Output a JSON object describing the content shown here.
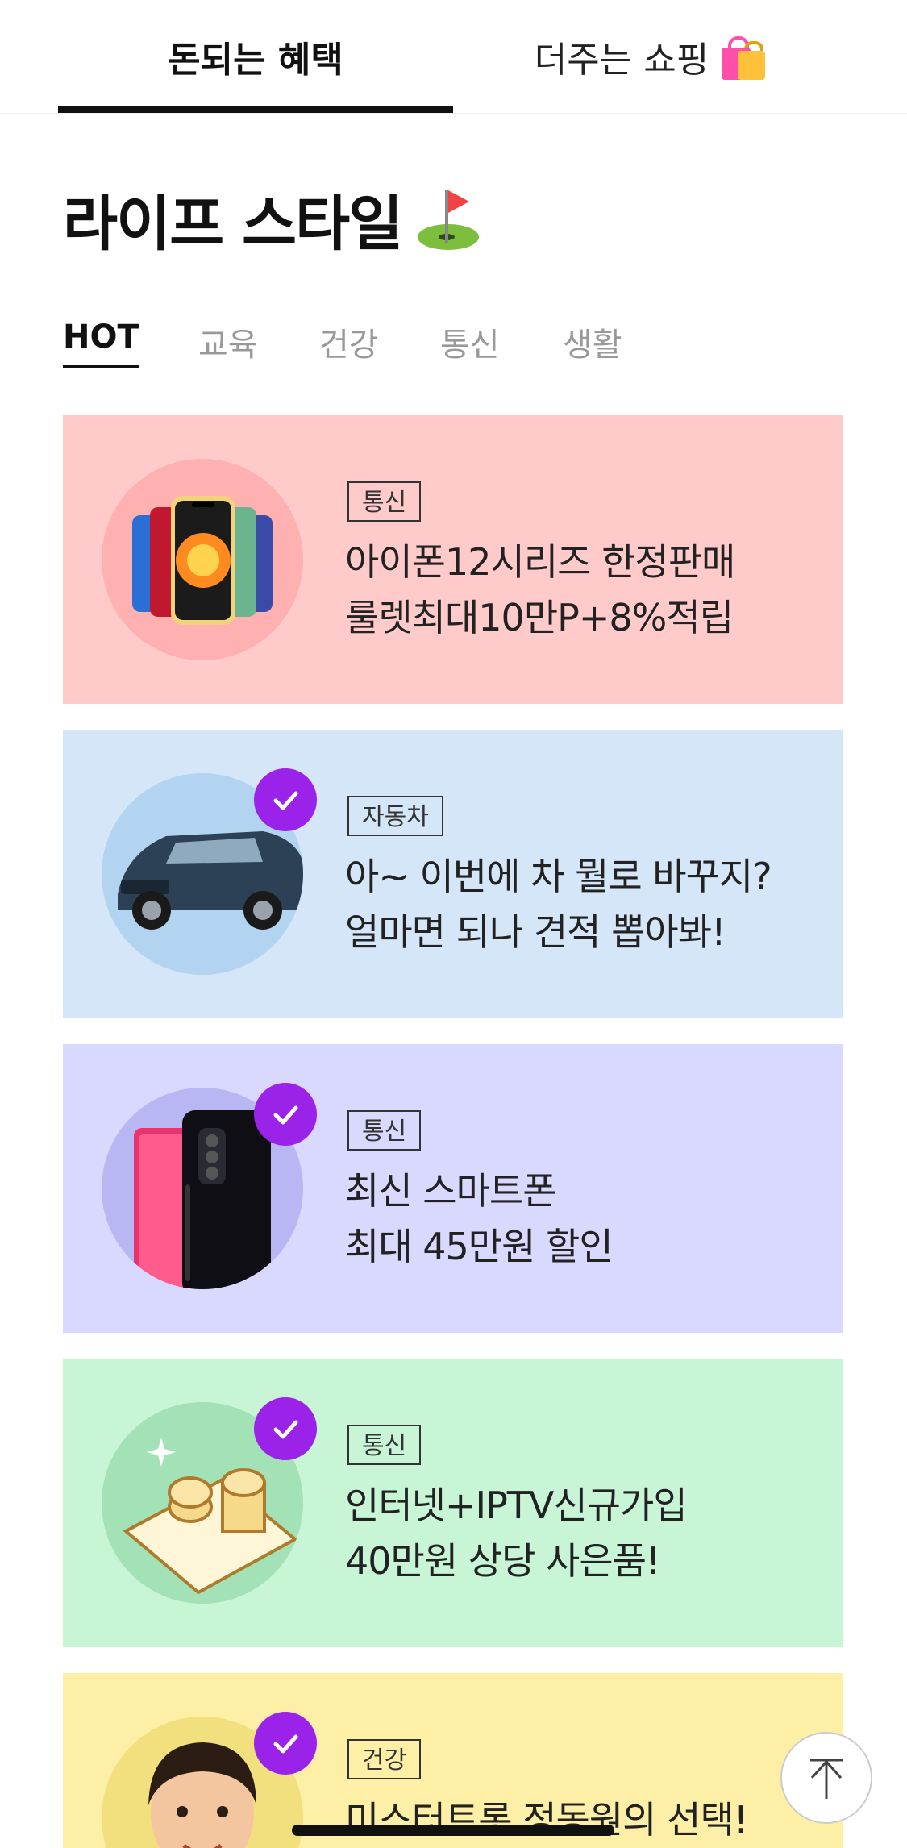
{
  "top_tabs": [
    {
      "label": "돈되는 혜택",
      "active": true
    },
    {
      "label": "더주는 쇼핑",
      "icon": "shopping-bags-icon"
    }
  ],
  "section": {
    "title": "라이프 스타일",
    "icon": "golf-flag-icon"
  },
  "category_tabs": [
    {
      "label": "HOT",
      "active": true
    },
    {
      "label": "교육"
    },
    {
      "label": "건강"
    },
    {
      "label": "통신"
    },
    {
      "label": "생활"
    }
  ],
  "cards": [
    {
      "tag": "통신",
      "line1": "아이폰12시리즈 한정판매",
      "line2": "룰렛최대10만P+8%적립",
      "bg": "#ffcaca",
      "circle": "#ffb0b0",
      "checked": false,
      "image": "iphone-icon"
    },
    {
      "tag": "자동차",
      "line1": "아~ 이번에 차 뭘로 바꾸지?",
      "line2": "얼마면 되나 견적 뽑아봐!",
      "bg": "#d4e6f7",
      "circle": "#b2d4f0",
      "checked": true,
      "image": "car-icon"
    },
    {
      "tag": "통신",
      "line1": "최신 스마트폰",
      "line2": "최대 45만원 할인",
      "bg": "#d9d8ff",
      "circle": "#b9b7f3",
      "checked": true,
      "image": "smartphone-icon"
    },
    {
      "tag": "통신",
      "line1": "인터넷+IPTV신규가입",
      "line2": "40만원 상당 사은품!",
      "bg": "#c7f5d6",
      "circle": "#a3e1b6",
      "checked": true,
      "image": "coins-phone-icon"
    },
    {
      "tag": "건강",
      "line1": "미스터트롯 정동원의 선택!",
      "line2": "",
      "bg": "#fdf0a6",
      "circle": "#f2e07f",
      "checked": true,
      "image": "boy-icon"
    }
  ],
  "accent": "#9b22e8",
  "scroll_top_icon": "arrow-up-icon"
}
